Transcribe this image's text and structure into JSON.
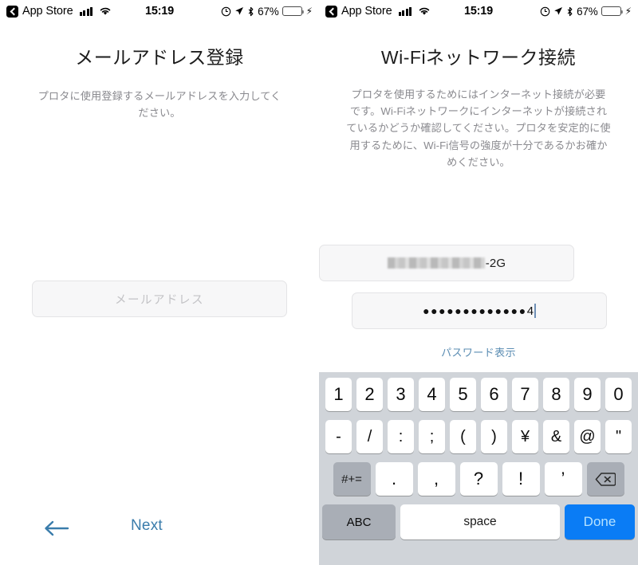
{
  "status_bar": {
    "back_app": "App Store",
    "time": "15:19",
    "battery_percent": "67%",
    "icons": [
      "back-chevron-icon",
      "signal-bars-icon",
      "wifi-icon",
      "orientation-lock-icon",
      "location-arrow-icon",
      "bluetooth-icon",
      "battery-icon",
      "charging-bolt-icon"
    ]
  },
  "screens": [
    {
      "title": "メールアドレス登録",
      "description": "プロタに使用登録するメールアドレスを入力してください。",
      "email_placeholder": "メールアドレス",
      "email_value": "",
      "back_label": "←",
      "next_label": "Next"
    },
    {
      "title": "Wi-Fiネットワーク接続",
      "description": "プロタを使用するためにはインターネット接続が必要です。Wi-Fiネットワークにインターネットが接続されているかどうか確認してください。プロタを安定的に使用するために、Wi-Fi信号の強度が十分であるかお確かめください。",
      "ssid_value_suffix": "-2G",
      "ssid_value_redacted": true,
      "password_masked": "●●●●●●●●●●●●●",
      "password_last_char": "4",
      "show_password_label": "パスワード表示"
    }
  ],
  "keyboard": {
    "row1": [
      "1",
      "2",
      "3",
      "4",
      "5",
      "6",
      "7",
      "8",
      "9",
      "0"
    ],
    "row2": [
      "-",
      "/",
      ":",
      ";",
      "(",
      ")",
      "¥",
      "&",
      "@",
      "\""
    ],
    "row3_mod": "#+=",
    "row3": [
      ".",
      ",",
      "?",
      "!",
      "’"
    ],
    "row3_backspace": "backspace-icon",
    "row4_abc": "ABC",
    "row4_space": "space",
    "row4_done": "Done",
    "done_color": "#0a7cf5"
  }
}
